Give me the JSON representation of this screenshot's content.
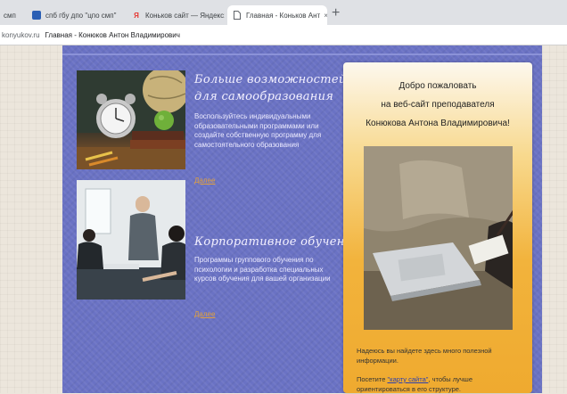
{
  "browser": {
    "tabs": [
      {
        "label": "смп",
        "icon": "tab-icon",
        "active": false
      },
      {
        "label": "спб гбу дпо \"цпо смп\"",
        "icon": "page-icon",
        "active": false
      },
      {
        "label": "Коньков сайт — Яндекс:",
        "icon": "yandex-icon",
        "active": false
      },
      {
        "label": "Главная - Коньков Ант",
        "icon": "document-icon",
        "active": true
      }
    ],
    "new_tab": "+",
    "close_glyph": "×",
    "url": "konyukov.ru",
    "page_title": "Главная - Конюков Антон Владимирович"
  },
  "sections": [
    {
      "title_line1": "Больше возможностей",
      "title_line2": "для самообразования",
      "text": "Воспользуйтесь индивидуальными образовательными программами или создайте собственную программу для самостоятельного образования",
      "link": "Далее"
    },
    {
      "title_line1": "Корпоративное обучение",
      "text": "Программы группового обучения по психологии и разработка специальных курсов обучения для вашей организации",
      "link": "Далее"
    }
  ],
  "welcome": {
    "line1": "Добро пожаловать",
    "line2": "на веб-сайт преподавателя",
    "line3": "Конюкова Антона Владимировича!",
    "text1": "Надеюсь вы найдете здесь много полезной информации.",
    "text2_prefix": "Посетите ",
    "text2_link": "\"карту сайта\"",
    "text2_suffix": ", чтобы лучше",
    "text3": "ориентироваться в его структуре."
  }
}
